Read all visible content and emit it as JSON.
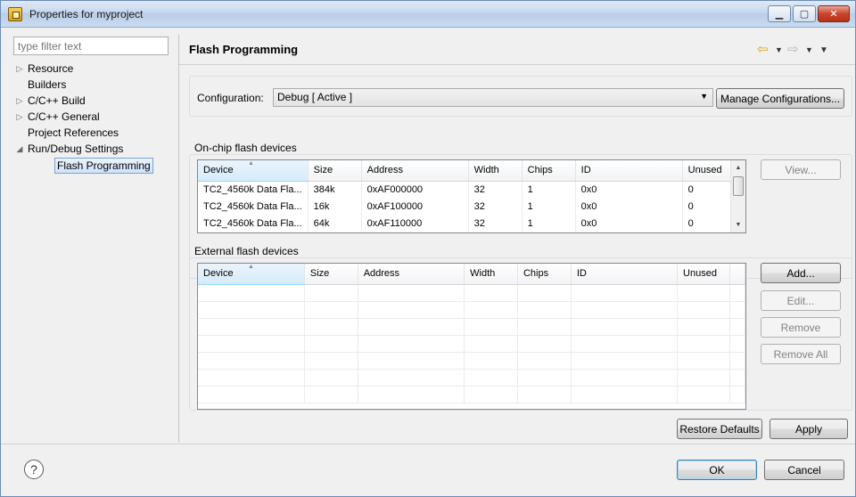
{
  "window": {
    "title": "Properties for myproject"
  },
  "filter": {
    "placeholder": "type filter text"
  },
  "tree": {
    "items": [
      {
        "label": "Resource",
        "arrow": "▷"
      },
      {
        "label": "Builders",
        "arrow": ""
      },
      {
        "label": "C/C++ Build",
        "arrow": "▷"
      },
      {
        "label": "C/C++ General",
        "arrow": "▷"
      },
      {
        "label": "Project References",
        "arrow": ""
      },
      {
        "label": "Run/Debug Settings",
        "arrow": "◢"
      },
      {
        "label": "Flash Programming",
        "arrow": "",
        "selected": true
      }
    ]
  },
  "page": {
    "title": "Flash Programming"
  },
  "config": {
    "label": "Configuration:",
    "value": "Debug  [ Active ]",
    "manage_label": "Manage Configurations..."
  },
  "onchip": {
    "title": "On-chip flash devices",
    "columns": [
      "Device",
      "Size",
      "Address",
      "Width",
      "Chips",
      "ID",
      "Unused"
    ],
    "rows": [
      [
        "TC2_4560k Data Fla...",
        "384k",
        "0xAF000000",
        "32",
        "1",
        "0x0",
        "0"
      ],
      [
        "TC2_4560k Data Fla...",
        "16k",
        "0xAF100000",
        "32",
        "1",
        "0x0",
        "0"
      ],
      [
        "TC2_4560k Data Fla...",
        "64k",
        "0xAF110000",
        "32",
        "1",
        "0x0",
        "0"
      ]
    ],
    "view_label": "View..."
  },
  "external": {
    "title": "External flash devices",
    "columns": [
      "Device",
      "Size",
      "Address",
      "Width",
      "Chips",
      "ID",
      "Unused"
    ],
    "add_label": "Add...",
    "edit_label": "Edit...",
    "remove_label": "Remove",
    "remove_all_label": "Remove All"
  },
  "buttons": {
    "restore_defaults": "Restore Defaults",
    "apply": "Apply",
    "ok": "OK",
    "cancel": "Cancel"
  },
  "icons": {
    "help": "?",
    "nav_back": "⇦",
    "nav_forward": "⇨"
  }
}
